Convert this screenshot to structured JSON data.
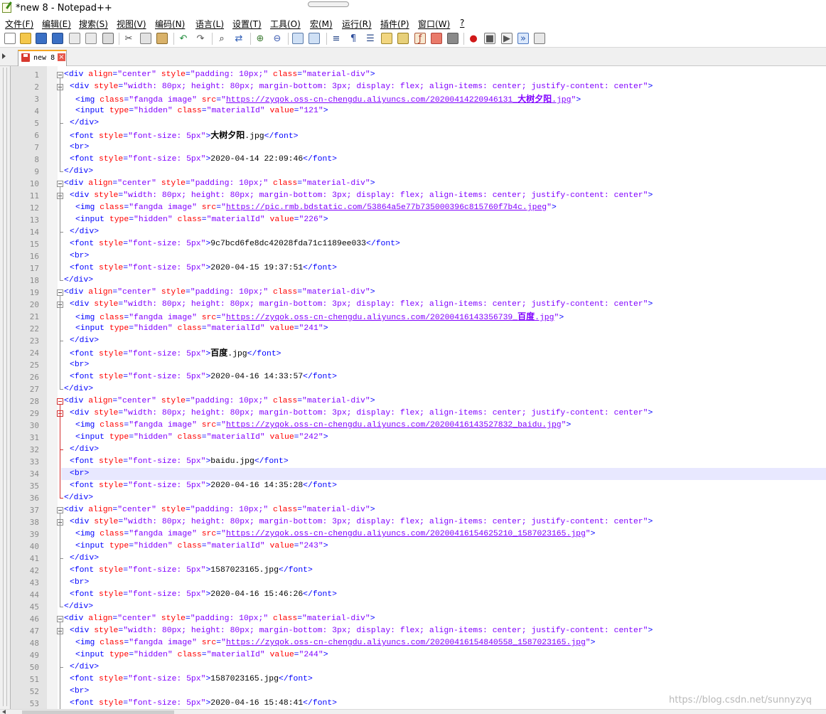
{
  "window": {
    "title": "*new 8 - Notepad++"
  },
  "menu": [
    "文件(F)",
    "编辑(E)",
    "搜索(S)",
    "视图(V)",
    "编码(N)",
    "语言(L)",
    "设置(T)",
    "工具(O)",
    "宏(M)",
    "运行(R)",
    "插件(P)",
    "窗口(W)",
    "?"
  ],
  "toolbar": {
    "icons": [
      "new-file-icon",
      "open-file-icon",
      "save-icon",
      "save-all-icon",
      "close-icon",
      "close-all-icon",
      "print-icon",
      "cut-icon",
      "copy-icon",
      "paste-icon",
      "undo-icon",
      "redo-icon",
      "find-icon",
      "replace-icon",
      "zoom-in-icon",
      "zoom-out-icon",
      "sync-vertical-icon",
      "sync-horizontal-icon",
      "word-wrap-icon",
      "show-all-chars-icon",
      "indent-guide-icon",
      "language-define-icon",
      "doc-map-icon",
      "function-list-icon",
      "folder-workspace-icon",
      "monitor-icon",
      "record-macro-icon",
      "stop-macro-icon",
      "play-macro-icon",
      "play-multi-macro-icon",
      "save-macro-icon"
    ]
  },
  "tab": {
    "label": "new 8"
  },
  "editor": {
    "current_line": 34,
    "lines": [
      {
        "n": "1",
        "indent": 0,
        "text": "<div align=\"center\" style=\"padding: 10px;\" class=\"material-div\">"
      },
      {
        "n": "2",
        "indent": 1,
        "text": "<div style=\"width: 80px; height: 80px; margin-bottom: 3px; display: flex; align-items: center; justify-content: center\">"
      },
      {
        "n": "3",
        "indent": 2,
        "text": "<img class=\"fangda image\" src=\"https://zyqok.oss-cn-chengdu.aliyuncs.com/20200414220946131_大树夕阳.jpg\">"
      },
      {
        "n": "4",
        "indent": 2,
        "text": "<input type=\"hidden\" class=\"materialId\" value=\"121\">"
      },
      {
        "n": "5",
        "indent": 1,
        "text": "</div>"
      },
      {
        "n": "6",
        "indent": 1,
        "text": "<font style=\"font-size: 5px\">大树夕阳.jpg</font>"
      },
      {
        "n": "7",
        "indent": 1,
        "text": "<br>"
      },
      {
        "n": "8",
        "indent": 1,
        "text": "<font style=\"font-size: 5px\">2020-04-14 22:09:46</font>"
      },
      {
        "n": "9",
        "indent": 0,
        "text": "</div>"
      },
      {
        "n": "10",
        "indent": 0,
        "text": "<div align=\"center\" style=\"padding: 10px;\" class=\"material-div\">"
      },
      {
        "n": "11",
        "indent": 1,
        "text": "<div style=\"width: 80px; height: 80px; margin-bottom: 3px; display: flex; align-items: center; justify-content: center\">"
      },
      {
        "n": "12",
        "indent": 2,
        "text": "<img class=\"fangda image\" src=\"https://pic.rmb.bdstatic.com/53864a5e77b735000396c815760f7b4c.jpeg\">"
      },
      {
        "n": "13",
        "indent": 2,
        "text": "<input type=\"hidden\" class=\"materialId\" value=\"226\">"
      },
      {
        "n": "14",
        "indent": 1,
        "text": "</div>"
      },
      {
        "n": "15",
        "indent": 1,
        "text": "<font style=\"font-size: 5px\">9c7bcd6fe8dc42028fda71c1189ee033</font>"
      },
      {
        "n": "16",
        "indent": 1,
        "text": "<br>"
      },
      {
        "n": "17",
        "indent": 1,
        "text": "<font style=\"font-size: 5px\">2020-04-15 19:37:51</font>"
      },
      {
        "n": "18",
        "indent": 0,
        "text": "</div>"
      },
      {
        "n": "19",
        "indent": 0,
        "text": "<div align=\"center\" style=\"padding: 10px;\" class=\"material-div\">"
      },
      {
        "n": "20",
        "indent": 1,
        "text": "<div style=\"width: 80px; height: 80px; margin-bottom: 3px; display: flex; align-items: center; justify-content: center\">"
      },
      {
        "n": "21",
        "indent": 2,
        "text": "<img class=\"fangda image\" src=\"https://zyqok.oss-cn-chengdu.aliyuncs.com/20200416143356739_百度.jpg\">"
      },
      {
        "n": "22",
        "indent": 2,
        "text": "<input type=\"hidden\" class=\"materialId\" value=\"241\">"
      },
      {
        "n": "23",
        "indent": 1,
        "text": "</div>"
      },
      {
        "n": "24",
        "indent": 1,
        "text": "<font style=\"font-size: 5px\">百度.jpg</font>"
      },
      {
        "n": "25",
        "indent": 1,
        "text": "<br>"
      },
      {
        "n": "26",
        "indent": 1,
        "text": "<font style=\"font-size: 5px\">2020-04-16 14:33:57</font>"
      },
      {
        "n": "27",
        "indent": 0,
        "text": "</div>"
      },
      {
        "n": "28",
        "indent": 0,
        "text": "<div align=\"center\" style=\"padding: 10px;\" class=\"material-div\">"
      },
      {
        "n": "29",
        "indent": 1,
        "text": "<div style=\"width: 80px; height: 80px; margin-bottom: 3px; display: flex; align-items: center; justify-content: center\">"
      },
      {
        "n": "30",
        "indent": 2,
        "text": "<img class=\"fangda image\" src=\"https://zyqok.oss-cn-chengdu.aliyuncs.com/20200416143527832_baidu.jpg\">"
      },
      {
        "n": "31",
        "indent": 2,
        "text": "<input type=\"hidden\" class=\"materialId\" value=\"242\">"
      },
      {
        "n": "32",
        "indent": 1,
        "text": "</div>"
      },
      {
        "n": "33",
        "indent": 1,
        "text": "<font style=\"font-size: 5px\">baidu.jpg</font>"
      },
      {
        "n": "34",
        "indent": 1,
        "text": "<br>"
      },
      {
        "n": "35",
        "indent": 1,
        "text": "<font style=\"font-size: 5px\">2020-04-16 14:35:28</font>"
      },
      {
        "n": "36",
        "indent": 0,
        "text": "</div>"
      },
      {
        "n": "37",
        "indent": 0,
        "text": "<div align=\"center\" style=\"padding: 10px;\" class=\"material-div\">"
      },
      {
        "n": "38",
        "indent": 1,
        "text": "<div style=\"width: 80px; height: 80px; margin-bottom: 3px; display: flex; align-items: center; justify-content: center\">"
      },
      {
        "n": "39",
        "indent": 2,
        "text": "<img class=\"fangda image\" src=\"https://zyqok.oss-cn-chengdu.aliyuncs.com/20200416154625210_1587023165.jpg\">"
      },
      {
        "n": "40",
        "indent": 2,
        "text": "<input type=\"hidden\" class=\"materialId\" value=\"243\">"
      },
      {
        "n": "41",
        "indent": 1,
        "text": "</div>"
      },
      {
        "n": "42",
        "indent": 1,
        "text": "<font style=\"font-size: 5px\">1587023165.jpg</font>"
      },
      {
        "n": "43",
        "indent": 1,
        "text": "<br>"
      },
      {
        "n": "44",
        "indent": 1,
        "text": "<font style=\"font-size: 5px\">2020-04-16 15:46:26</font>"
      },
      {
        "n": "45",
        "indent": 0,
        "text": "</div>"
      },
      {
        "n": "46",
        "indent": 0,
        "text": "<div align=\"center\" style=\"padding: 10px;\" class=\"material-div\">"
      },
      {
        "n": "47",
        "indent": 1,
        "text": "<div style=\"width: 80px; height: 80px; margin-bottom: 3px; display: flex; align-items: center; justify-content: center\">"
      },
      {
        "n": "48",
        "indent": 2,
        "text": "<img class=\"fangda image\" src=\"https://zyqok.oss-cn-chengdu.aliyuncs.com/20200416154840558_1587023165.jpg\">"
      },
      {
        "n": "49",
        "indent": 2,
        "text": "<input type=\"hidden\" class=\"materialId\" value=\"244\">"
      },
      {
        "n": "50",
        "indent": 1,
        "text": "</div>"
      },
      {
        "n": "51",
        "indent": 1,
        "text": "<font style=\"font-size: 5px\">1587023165.jpg</font>"
      },
      {
        "n": "52",
        "indent": 1,
        "text": "<br>"
      },
      {
        "n": "53",
        "indent": 1,
        "text": "<font style=\"font-size: 5px\">2020-04-16 15:48:41</font>"
      }
    ]
  },
  "watermark": "https://blog.csdn.net/sunnyzyq",
  "colors": {
    "tag": "#0000ff",
    "attribute": "#ff0000",
    "value": "#8000ff",
    "current_line": "#e8e8ff",
    "fold_marker_active": "#d12d2d"
  }
}
